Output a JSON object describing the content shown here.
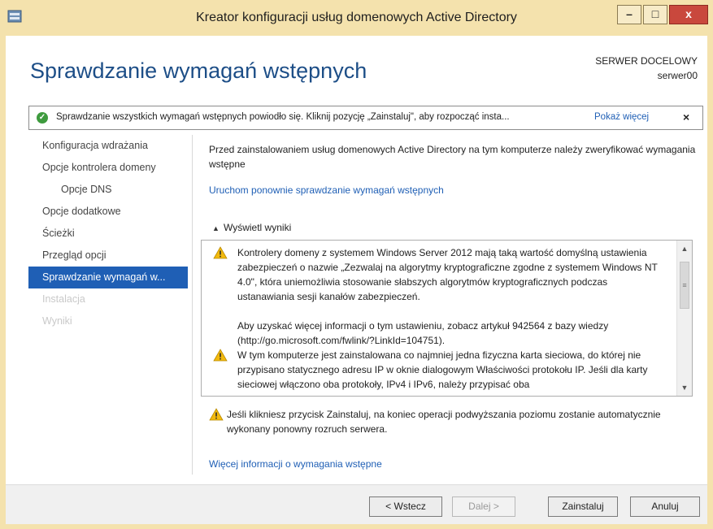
{
  "window": {
    "title": "Kreator konfiguracji usług domenowych Active Directory",
    "minimize_label": "–",
    "maximize_label": "□",
    "close_label": "x"
  },
  "page": {
    "heading": "Sprawdzanie wymagań wstępnych",
    "target_server_label": "SERWER DOCELOWY",
    "target_server_name": "serwer00"
  },
  "banner": {
    "icon": "check-circle-icon",
    "text": "Sprawdzanie wszystkich wymagań wstępnych powiodło się. Kliknij pozycję „Zainstaluj\", aby rozpocząć insta...",
    "more_link": "Pokaż więcej",
    "close_label": "×"
  },
  "nav": {
    "items": [
      {
        "label": "Konfiguracja wdrażania",
        "state": "normal"
      },
      {
        "label": "Opcje kontrolera domeny",
        "state": "normal"
      },
      {
        "label": "Opcje DNS",
        "state": "normal"
      },
      {
        "label": "Opcje dodatkowe",
        "state": "normal"
      },
      {
        "label": "Ścieżki",
        "state": "normal"
      },
      {
        "label": "Przegląd opcji",
        "state": "normal"
      },
      {
        "label": "Sprawdzanie wymagań w...",
        "state": "active"
      },
      {
        "label": "Instalacja",
        "state": "disabled"
      },
      {
        "label": "Wyniki",
        "state": "disabled"
      }
    ]
  },
  "content": {
    "intro": "Przed zainstalowaniem usług domenowych Active Directory na tym komputerze należy zweryfikować wymagania wstępne",
    "rerun_link": "Uruchom ponownie sprawdzanie wymagań wstępnych",
    "results_toggle": "Wyświetl wyniki",
    "results": [
      {
        "icon": "warning-icon",
        "text": "Kontrolery domeny z systemem Windows Server 2012 mają taką wartość domyślną ustawienia zabezpieczeń o nazwie „Zezwalaj na algorytmy kryptograficzne zgodne z systemem Windows NT 4.0\", która uniemożliwia stosowanie słabszych algorytmów kryptograficznych podczas ustanawiania sesji kanałów zabezpieczeń."
      },
      {
        "icon": "",
        "text": "Aby uzyskać więcej informacji o tym ustawieniu, zobacz artykuł 942564 z bazy wiedzy (http://go.microsoft.com/fwlink/?LinkId=104751)."
      },
      {
        "icon": "warning-icon",
        "text": "W tym komputerze jest zainstalowana co najmniej jedna fizyczna karta sieciowa, do której nie przypisano statycznego adresu IP w oknie dialogowym Właściwości protokołu IP. Jeśli dla karty sieciowej włączono oba protokoły, IPv4 i IPv6, należy przypisać oba"
      }
    ],
    "footnote": "Jeśli klikniesz przycisk Zainstaluj, na koniec operacji podwyższania poziomu zostanie automatycznie wykonany ponowny rozruch serwera.",
    "more_info_link": "Więcej informacji o wymagania wstępne"
  },
  "buttons": {
    "back": "< Wstecz",
    "next": "Dalej >",
    "install": "Zainstaluj",
    "cancel": "Anuluj"
  },
  "colors": {
    "accent": "#1f5fb5",
    "window_frame": "#f4e2ad",
    "success": "#3e9b3e",
    "warning": "#f2b90d"
  }
}
